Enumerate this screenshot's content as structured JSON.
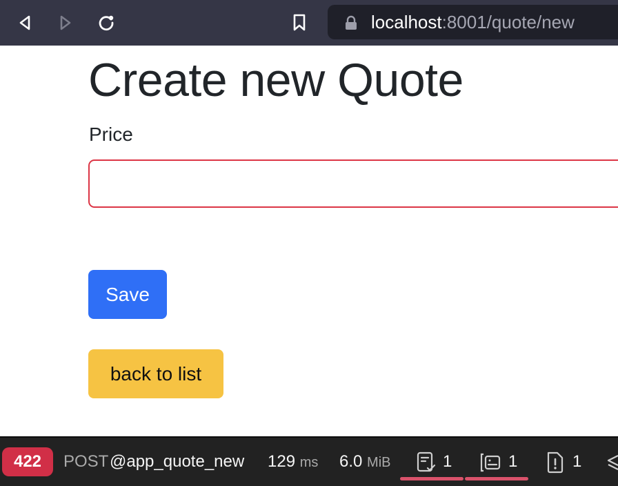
{
  "browser": {
    "url_host": "localhost",
    "url_path": ":8001/quote/new"
  },
  "page": {
    "title": "Create new Quote",
    "price_label": "Price",
    "price_value": "",
    "save_label": "Save",
    "back_label": "back to list"
  },
  "toolbar": {
    "status_code": "422",
    "method": "POST",
    "route": "@app_quote_new",
    "time_value": "129",
    "time_unit": "ms",
    "memory_value": "6.0",
    "memory_unit": "MiB",
    "forms_count": "1",
    "validator_count": "1",
    "logs_count": "1"
  },
  "colors": {
    "status_error": "#d12f47",
    "primary": "#2f6ff6",
    "warning": "#f6c343",
    "invalid_border": "#dc3545"
  },
  "icons": [
    "back-icon",
    "forward-icon",
    "reload-icon",
    "bookmark-icon",
    "lock-icon",
    "form-icon",
    "validator-icon",
    "logs-icon",
    "layers-icon"
  ]
}
